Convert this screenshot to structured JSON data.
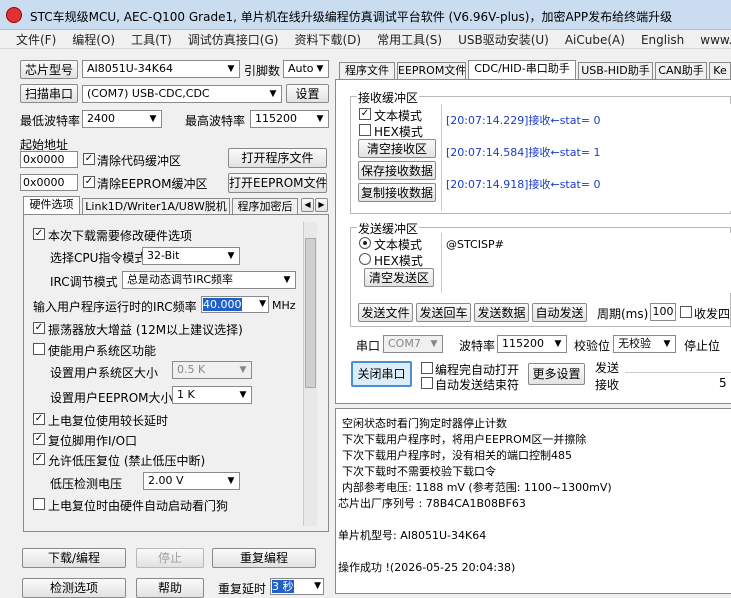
{
  "window": {
    "title": "STC车规级MCU, AEC-Q100 Grade1, 单片机在线升级编程仿真调试平台软件 (V6.96V-plus)，加密APP发布给终端升级"
  },
  "menu": [
    "文件(F)",
    "编程(O)",
    "工具(T)",
    "调试仿真接口(G)",
    "资料下载(D)",
    "常用工具(S)",
    "USB驱动安装(U)",
    "AiCube(A)",
    "English",
    "www.STCA"
  ],
  "left": {
    "chip_model_button": "芯片型号",
    "chip_model_value": "AI8051U-34K64",
    "pin_count_label": "引脚数",
    "pin_count_value": "Auto",
    "scan_port_button": "扫描串口",
    "port_value": "(COM7) USB-CDC,CDC",
    "settings_button": "设置",
    "min_baud_label": "最低波特率",
    "min_baud_value": "2400",
    "max_baud_label": "最高波特率",
    "max_baud_value": "115200",
    "start_addr_label": "起始地址",
    "code_addr": "0x0000",
    "clear_code_label": "清除代码缓冲区",
    "open_program_button": "打开程序文件",
    "eeprom_addr": "0x0000",
    "clear_eeprom_label": "清除EEPROM缓冲区",
    "open_eeprom_button": "打开EEPROM文件",
    "tabs": [
      "硬件选项",
      "Link1D/Writer1A/U8W脱机",
      "程序加密后"
    ],
    "hw": {
      "modify_options": "本次下载需要修改硬件选项",
      "cpu_instr_label": "选择CPU指令模式",
      "cpu_instr_value": "32-Bit",
      "irc_mode_label": "IRC调节模式",
      "irc_mode_value": "总是动态调节IRC频率",
      "irc_freq_label": "输入用户程序运行时的IRC频率",
      "irc_freq_value": "40.000",
      "irc_freq_unit": "MHz",
      "osc_gain": "振荡器放大增益 (12M以上建议选择)",
      "use_sys_area": "使能用户系统区功能",
      "sys_area_size_label": "设置用户系统区大小",
      "sys_area_size_value": "0.5 K",
      "eeprom_size_label": "设置用户EEPROM大小",
      "eeprom_size_value": "1     K",
      "power_on_delay": "上电复位使用较长延时",
      "reset_pin_io": "复位脚用作I/O口",
      "low_volt_reset": "允许低压复位 (禁止低压中断)",
      "low_volt_label": "低压检测电压",
      "low_volt_value": "2.00 V",
      "wdt_on_power": "上电复位时由硬件自动启动看门狗"
    },
    "download_button": "下载/编程",
    "stop_button": "停止",
    "reprogram_button": "重复编程",
    "detect_button": "检测选项",
    "help_button": "帮助",
    "retry_delay_label": "重复延时",
    "retry_delay_value": "3 秒"
  },
  "right": {
    "tabs": [
      "程序文件",
      "EEPROM文件",
      "CDC/HID-串口助手",
      "USB-HID助手",
      "CAN助手",
      "Ke"
    ],
    "recv": {
      "group_label": "接收缓冲区",
      "text_mode": "文本模式",
      "hex_mode": "HEX模式",
      "clear_button": "清空接收区",
      "save_button": "保存接收数据",
      "copy_button": "复制接收数据",
      "lines": [
        "[20:07:14.229]接收←stat= 0",
        "[20:07:14.584]接收←stat= 1",
        "[20:07:14.918]接收←stat= 0"
      ]
    },
    "send": {
      "group_label": "发送缓冲区",
      "text_mode": "文本模式",
      "hex_mode": "HEX模式",
      "clear_button": "清空发送区",
      "content": "@STCISP#",
      "send_file_button": "发送文件",
      "send_return_button": "发送回车",
      "send_data_button": "发送数据",
      "auto_send_button": "自动发送",
      "period_label": "周期(ms)",
      "period_value": "100",
      "recv_send_label": "收发四"
    },
    "port_label": "串口",
    "port_value": "COM7",
    "baud_label": "波特率",
    "baud_value": "115200",
    "parity_label": "校验位",
    "parity_value": "无校验",
    "stop_label": "停止位",
    "close_port_button": "关闭串口",
    "auto_open_label": "编程完自动打开",
    "auto_send_end_label": "自动发送结束符",
    "more_settings_button": "更多设置",
    "send_stat_label": "发送",
    "recv_stat_label": "接收",
    "recv_stat_value": "5"
  },
  "log": [
    "  空闲状态时看门狗定时器停止计数",
    "  下次下载用户程序时，将用户EEPROM区一并擦除",
    "  下次下载用户程序时，没有相关的端口控制485",
    "  下次下载时不需要校验下载口令",
    "  内部参考电压: 1188 mV (参考范围: 1100~1300mV)",
    "芯片出厂序列号 : 78B4CA1B08BF63",
    "",
    "  单片机型号: AI8051U-34K64",
    "",
    "操作成功 !(2026-05-25 20:04:38)"
  ]
}
